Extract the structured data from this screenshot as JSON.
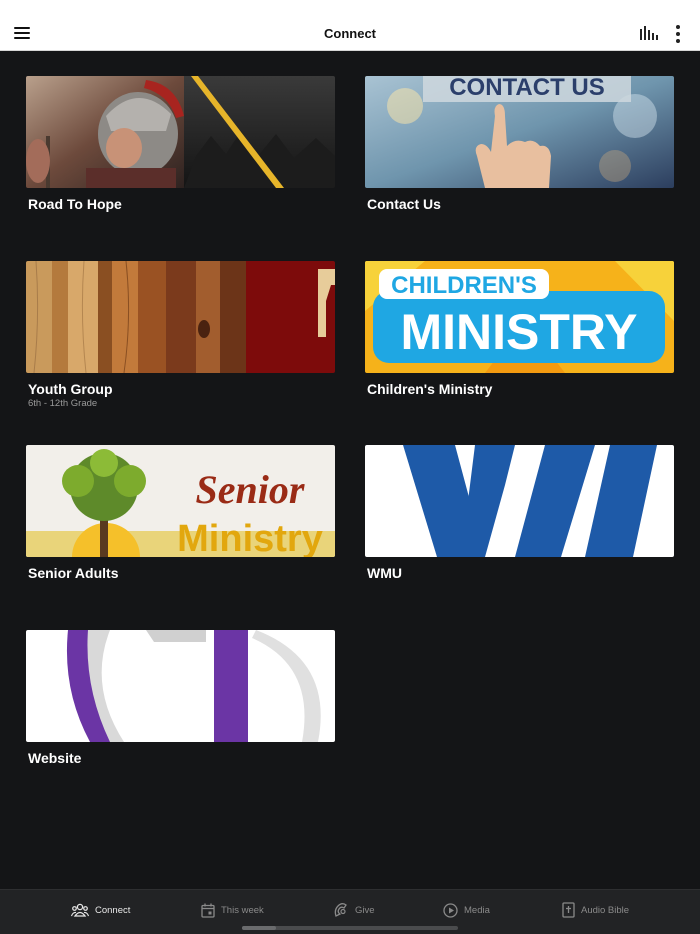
{
  "header": {
    "title": "Connect"
  },
  "cards": [
    {
      "title": "Road To Hope",
      "subtitle": ""
    },
    {
      "title": "Contact Us",
      "subtitle": "",
      "image_text": "CONTACT US"
    },
    {
      "title": "Youth Group",
      "subtitle": "6th - 12th Grade"
    },
    {
      "title": "Children's Ministry",
      "subtitle": "",
      "image_text_top": "CHILDREN'S",
      "image_text_main": "MINISTRY"
    },
    {
      "title": "Senior Adults",
      "subtitle": "",
      "image_text_top": "Senior",
      "image_text_main": "Ministry"
    },
    {
      "title": "WMU",
      "subtitle": ""
    },
    {
      "title": "Website",
      "subtitle": ""
    }
  ],
  "tabs": [
    {
      "label": "Connect",
      "icon": "people-icon",
      "active": true
    },
    {
      "label": "This week",
      "icon": "calendar-icon",
      "active": false
    },
    {
      "label": "Give",
      "icon": "give-icon",
      "active": false
    },
    {
      "label": "Media",
      "icon": "play-circle-icon",
      "active": false
    },
    {
      "label": "Audio Bible",
      "icon": "bible-icon",
      "active": false
    }
  ],
  "colors": {
    "background": "#141517",
    "header_bg": "#ffffff",
    "tabbar_bg": "#222325",
    "card_title": "#ffffff",
    "subtitle": "#9a9a9a"
  }
}
